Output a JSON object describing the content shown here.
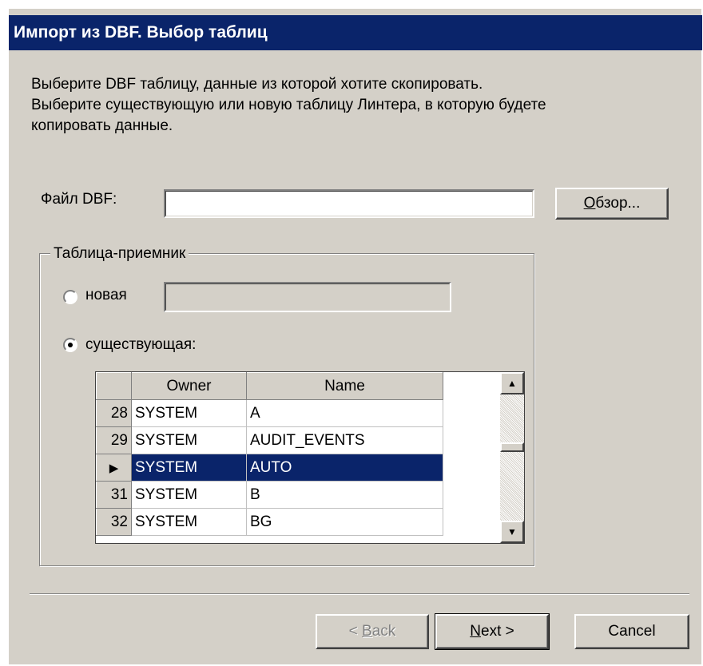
{
  "window": {
    "title": "Импорт из DBF. Выбор таблиц"
  },
  "description": {
    "line1": "Выберите DBF таблицу, данные из которой хотите скопировать.",
    "line2": "Выберите существующую или новую таблицу Линтера, в которую будете",
    "line3": "копировать данные."
  },
  "file": {
    "label": "Файл DBF:",
    "value": "",
    "browse_label_accel": "О",
    "browse_label_rest": "бзор..."
  },
  "target": {
    "group_label": "Таблица-приемник",
    "new_label": "новая",
    "new_value": "",
    "existing_label": "существующая:",
    "selected_option": "existing"
  },
  "grid": {
    "columns": [
      "Owner",
      "Name"
    ],
    "rows": [
      {
        "indicator": "28",
        "owner": "SYSTEM",
        "name": "A"
      },
      {
        "indicator": "29",
        "owner": "SYSTEM",
        "name": "AUDIT_EVENTS"
      },
      {
        "indicator": "▶",
        "owner": "SYSTEM",
        "name": "AUTO",
        "selected": true
      },
      {
        "indicator": "31",
        "owner": "SYSTEM",
        "name": "B"
      },
      {
        "indicator": "32",
        "owner": "SYSTEM",
        "name": "BG"
      }
    ]
  },
  "buttons": {
    "back_prefix": "< ",
    "back_accel": "B",
    "back_rest": "ack",
    "next_accel": "N",
    "next_rest": "ext >",
    "cancel": "Cancel"
  },
  "colors": {
    "titlebar": "#0a246a",
    "dialog_bg": "#d4d0c8",
    "selection": "#0a246a"
  }
}
